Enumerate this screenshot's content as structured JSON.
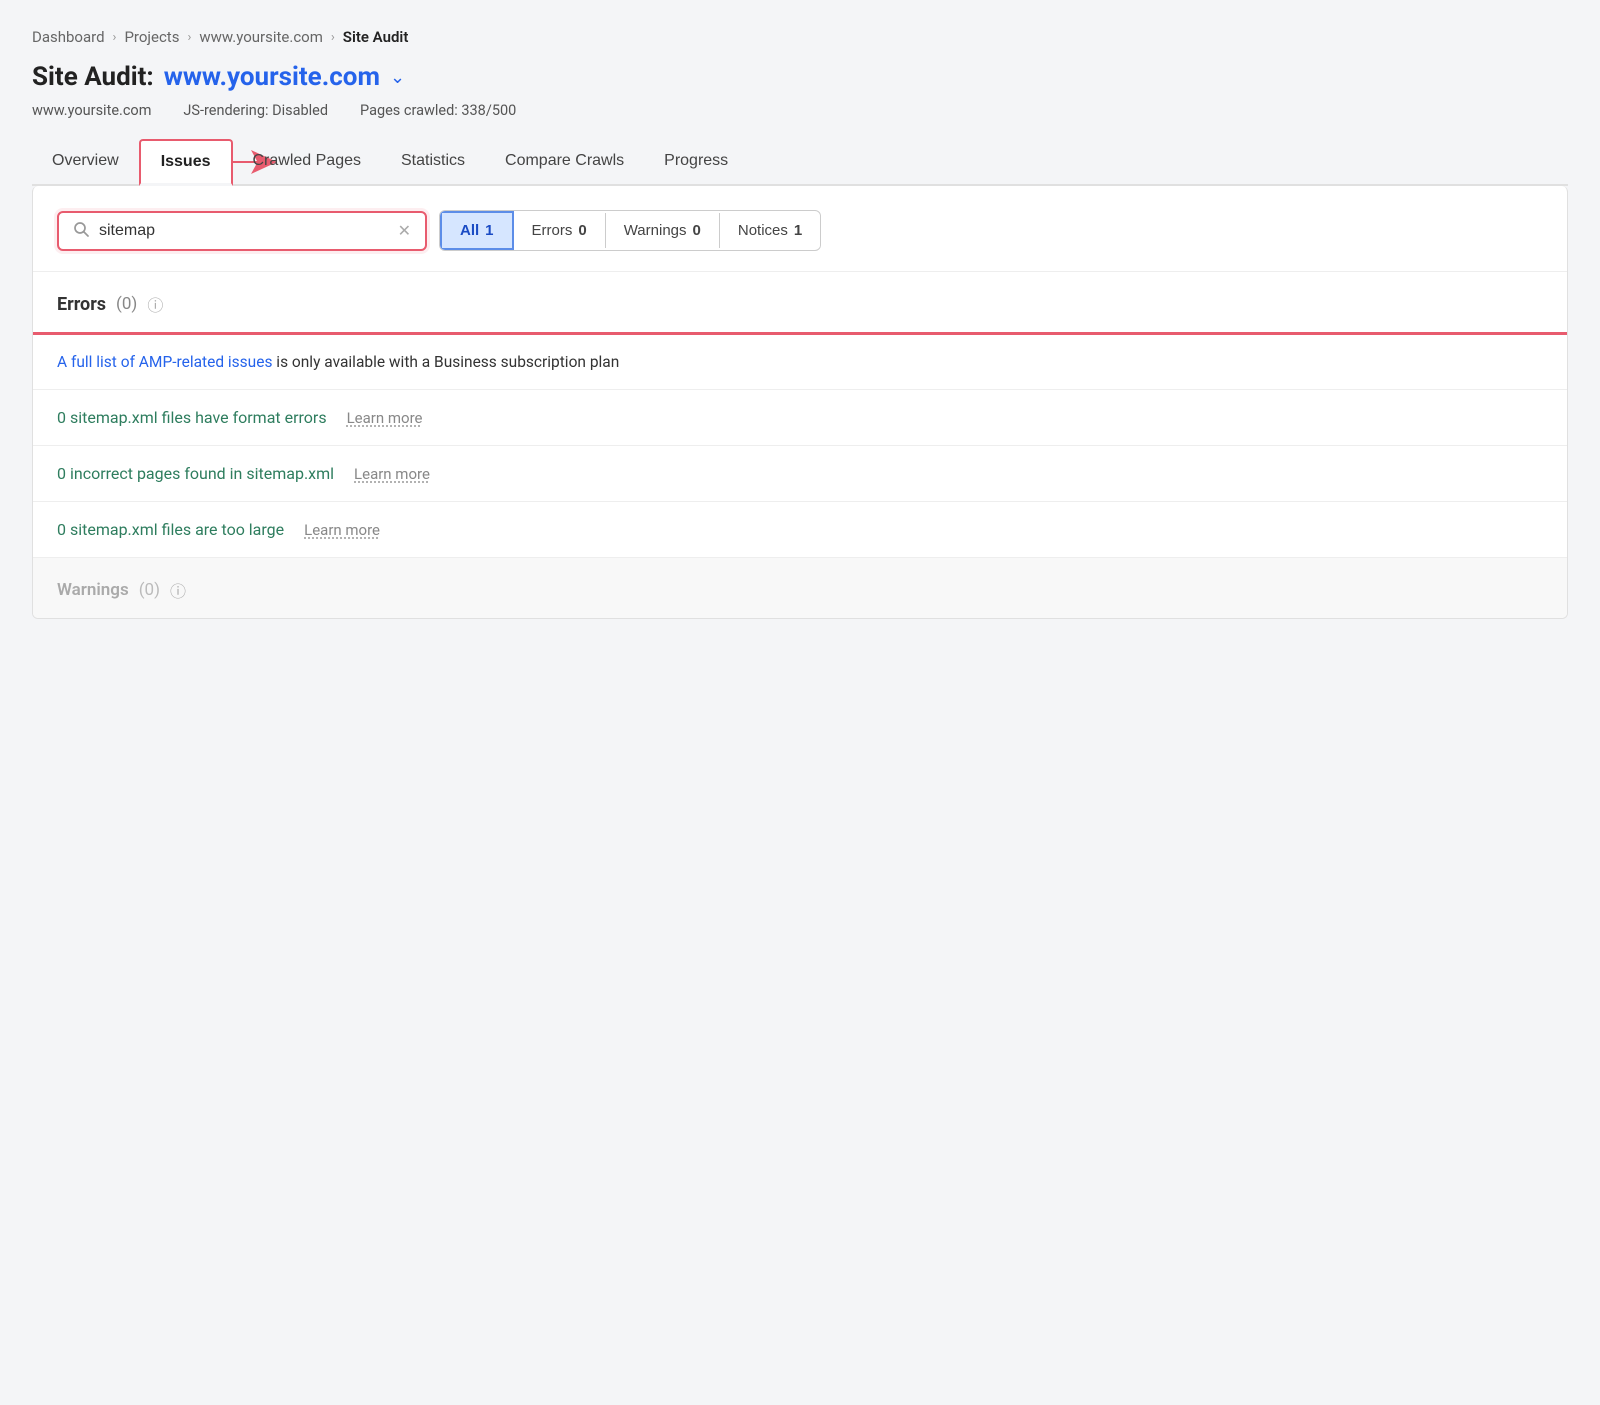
{
  "breadcrumb": {
    "items": [
      "Dashboard",
      "Projects",
      "www.yoursite.com",
      "Site Audit"
    ]
  },
  "page_title": {
    "static": "Site Audit:",
    "site": "www.yoursite.com",
    "dropdown_char": "∨"
  },
  "meta": {
    "site": "www.yoursite.com",
    "js_rendering": "JS-rendering: Disabled",
    "pages_crawled": "Pages crawled: 338/500"
  },
  "tabs": [
    {
      "id": "overview",
      "label": "Overview",
      "active": false
    },
    {
      "id": "issues",
      "label": "Issues",
      "active": true
    },
    {
      "id": "crawled-pages",
      "label": "Crawled Pages",
      "active": false
    },
    {
      "id": "statistics",
      "label": "Statistics",
      "active": false
    },
    {
      "id": "compare-crawls",
      "label": "Compare Crawls",
      "active": false
    },
    {
      "id": "progress",
      "label": "Progress",
      "active": false
    }
  ],
  "filter_bar": {
    "search_placeholder": "sitemap",
    "search_value": "sitemap",
    "buttons": [
      {
        "id": "all",
        "label": "All",
        "count": "1",
        "selected": true
      },
      {
        "id": "errors",
        "label": "Errors",
        "count": "0",
        "selected": false
      },
      {
        "id": "warnings",
        "label": "Warnings",
        "count": "0",
        "selected": false
      },
      {
        "id": "notices",
        "label": "Notices",
        "count": "1",
        "selected": false
      }
    ]
  },
  "sections": {
    "errors": {
      "title": "Errors",
      "count": "(0)",
      "rows": [
        {
          "id": "amp-row",
          "amp_link_text": "A full list of AMP-related issues",
          "amp_rest": " is only available with a Business subscription plan"
        },
        {
          "id": "sitemap-format",
          "issue_text": "0 sitemap.xml files have format errors",
          "learn_more": "Learn more"
        },
        {
          "id": "sitemap-incorrect",
          "issue_text": "0 incorrect pages found in sitemap.xml",
          "learn_more": "Learn more"
        },
        {
          "id": "sitemap-large",
          "issue_text": "0 sitemap.xml files are too large",
          "learn_more": "Learn more"
        }
      ]
    },
    "warnings": {
      "title": "Warnings",
      "count": "(0)"
    }
  },
  "icons": {
    "search": "🔍",
    "clear": "✕",
    "info": "ⓘ",
    "dropdown": "⌄"
  },
  "colors": {
    "accent_red": "#e85b6e",
    "accent_blue": "#2563eb",
    "green_link": "#2e7d5e",
    "tab_border": "#e85b6e"
  }
}
